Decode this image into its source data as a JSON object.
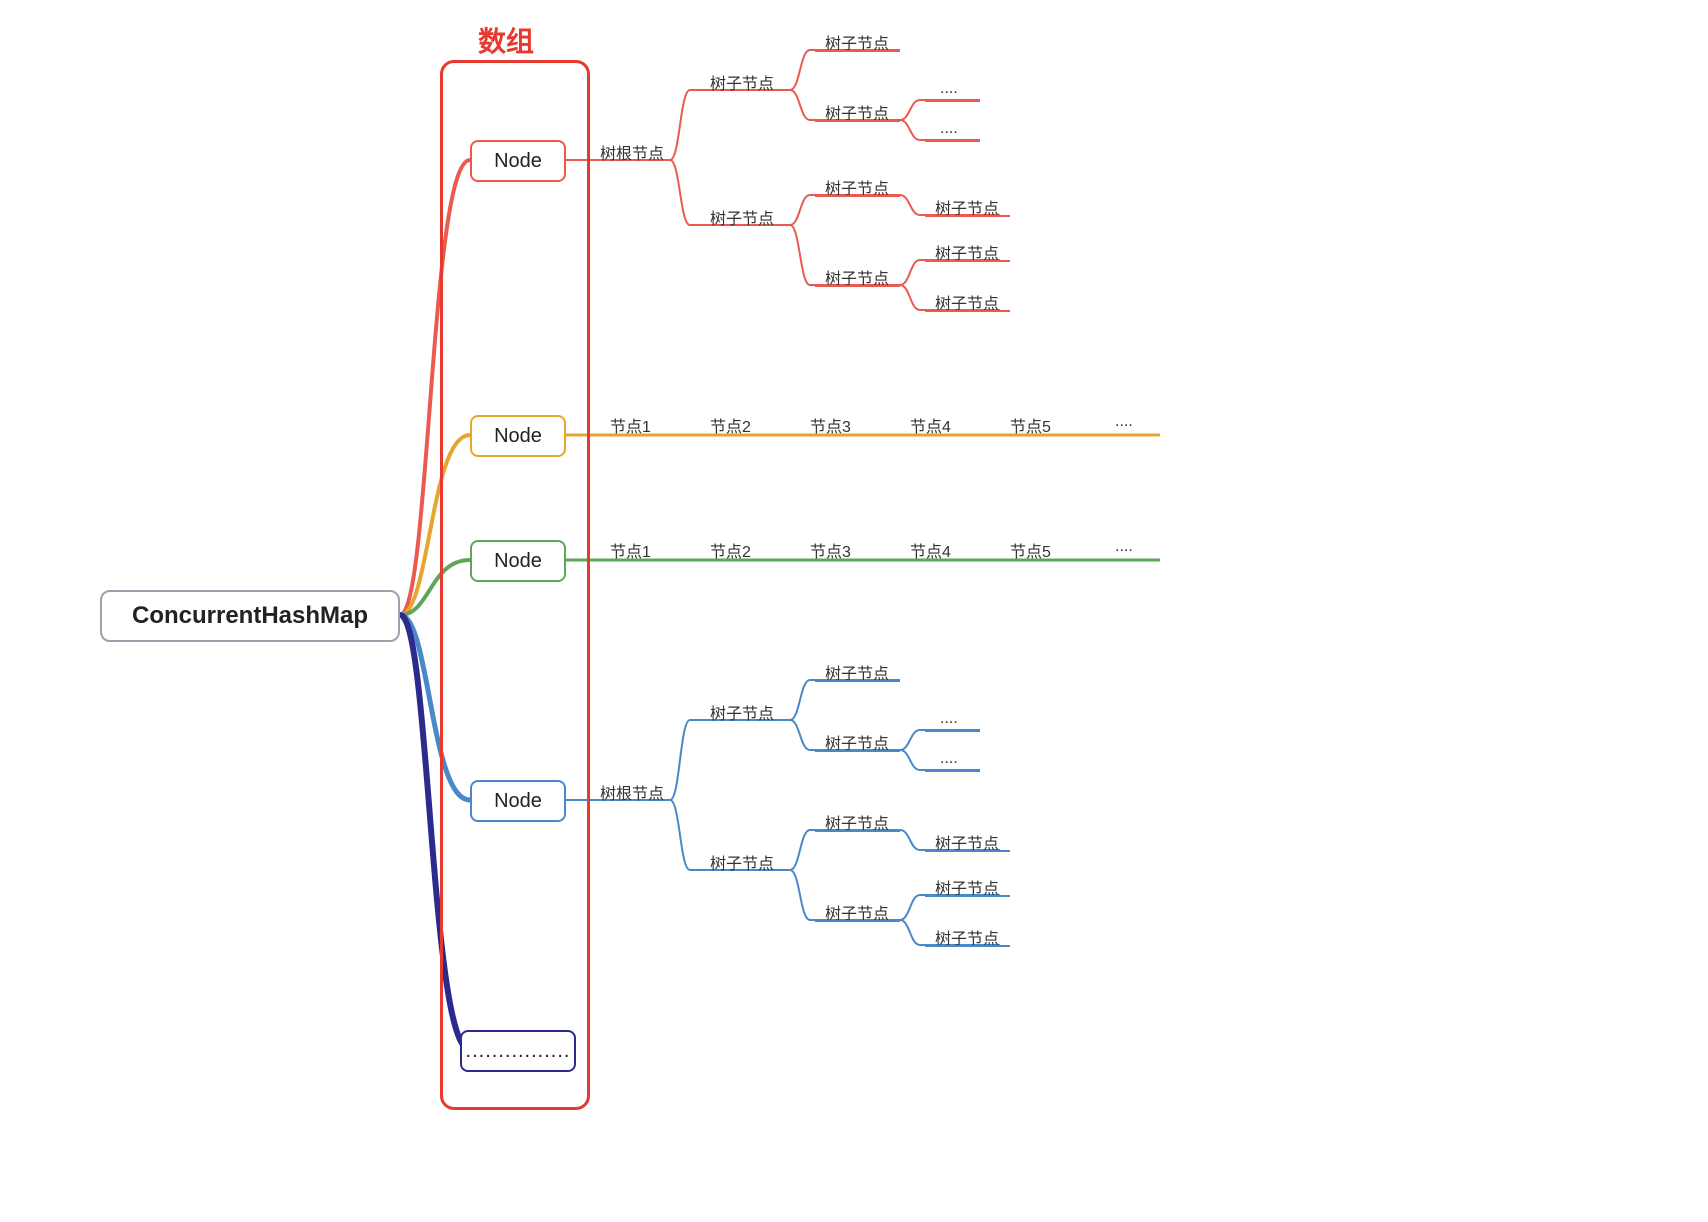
{
  "root": {
    "title": "ConcurrentHashMap"
  },
  "array": {
    "label": "数组"
  },
  "slots": [
    {
      "label": "Node",
      "color": "red"
    },
    {
      "label": "Node",
      "color": "yellow"
    },
    {
      "label": "Node",
      "color": "green"
    },
    {
      "label": "Node",
      "color": "blue"
    },
    {
      "label": "................",
      "color": "purple"
    }
  ],
  "tree_labels": {
    "root": "树根节点",
    "child": "树子节点",
    "leaf": "树子节点",
    "dots": "...."
  },
  "linked_list": {
    "yellow": [
      "节点1",
      "节点2",
      "节点3",
      "节点4",
      "节点5",
      "...."
    ],
    "green": [
      "节点1",
      "节点2",
      "节点3",
      "节点4",
      "节点5",
      "...."
    ]
  },
  "colors": {
    "red": "#ea5a50",
    "yellow": "#e8a52e",
    "green": "#5fa55b",
    "blue": "#4a89c9",
    "purple": "#2b2a8f",
    "array_border": "#e8392f",
    "root_border": "#9aa2ad"
  }
}
